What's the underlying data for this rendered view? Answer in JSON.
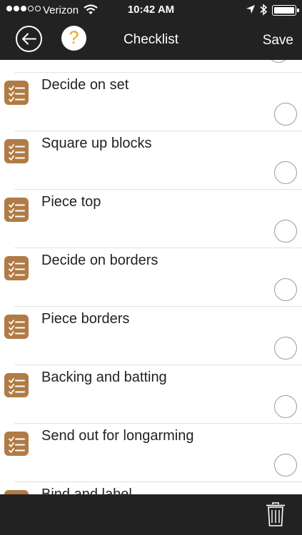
{
  "status_bar": {
    "carrier": "Verizon",
    "time": "10:42 AM",
    "signal_bars_filled": 3,
    "signal_bars_total": 5
  },
  "nav": {
    "title": "Checklist",
    "save_label": "Save",
    "help_glyph": "?",
    "back_icon": "arrow-left-circle-icon",
    "help_icon": "question-mark-icon"
  },
  "checklist": {
    "items": [
      {
        "label": "Decide on set",
        "checked": false
      },
      {
        "label": "Square up blocks",
        "checked": false
      },
      {
        "label": "Piece top",
        "checked": false
      },
      {
        "label": "Decide on borders",
        "checked": false
      },
      {
        "label": "Piece borders",
        "checked": false
      },
      {
        "label": "Backing and batting",
        "checked": false
      },
      {
        "label": "Send out for longarming",
        "checked": false
      },
      {
        "label": "Bind and label",
        "checked": false
      }
    ]
  },
  "bottom_bar": {
    "trash_icon": "trash-icon"
  },
  "colors": {
    "bar_background": "#222222",
    "item_icon": "#b07b46",
    "help_accent": "#f0a020"
  }
}
